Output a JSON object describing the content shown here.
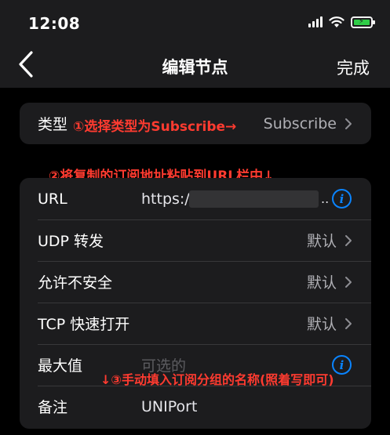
{
  "status": {
    "time": "12:08"
  },
  "nav": {
    "title": "编辑节点",
    "done": "完成"
  },
  "type_row": {
    "label": "类型",
    "value": "Subscribe",
    "annotation": "①选择类型为Subscribe→"
  },
  "annotation2": "②将复制的订阅地址粘贴到URL栏中↓",
  "rows": {
    "url": {
      "label": "URL",
      "value": "https://",
      "trail": ".."
    },
    "udp": {
      "label": "UDP 转发",
      "value": "默认"
    },
    "insecure": {
      "label": "允许不安全",
      "value": "默认"
    },
    "tcp": {
      "label": "TCP 快速打开",
      "value": "默认"
    },
    "max": {
      "label": "最大值",
      "placeholder": "可选的"
    },
    "note": {
      "label": "备注",
      "value": "UNIPort"
    }
  },
  "annotation3": "↓③手动填入订阅分组的名称(照着写即可)",
  "info_glyph": "i",
  "colors": {
    "accent": "#0a84ff",
    "annotation": "#ff3b30",
    "battery": "#32d74b"
  }
}
